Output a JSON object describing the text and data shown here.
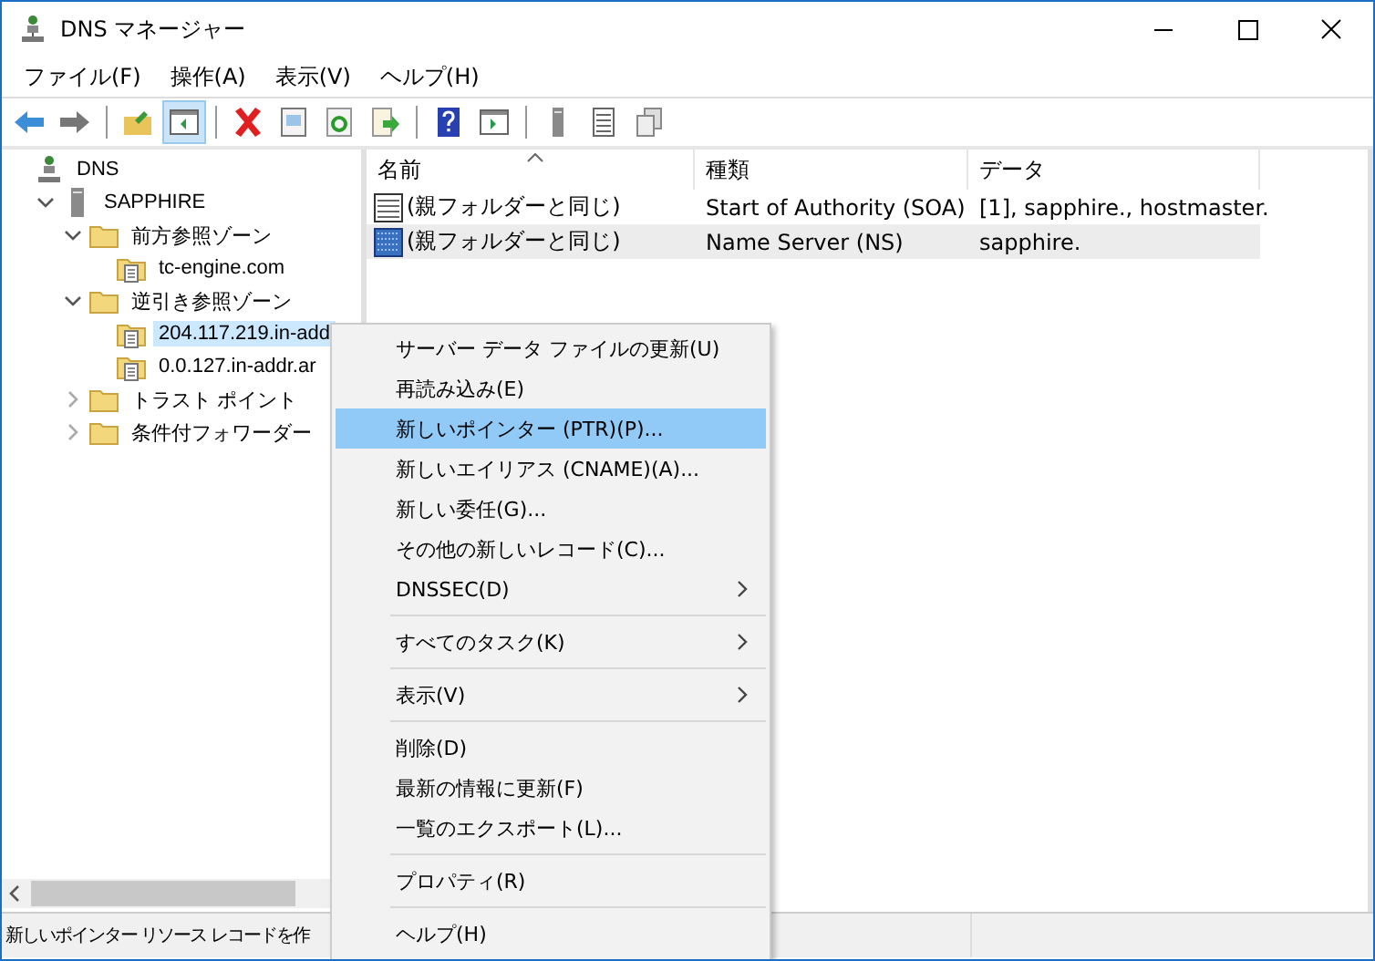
{
  "window": {
    "title": "DNS マネージャー"
  },
  "menu_bar": [
    "ファイル(F)",
    "操作(A)",
    "表示(V)",
    "ヘルプ(H)"
  ],
  "toolbar": [
    {
      "kind": "back",
      "pressed": false
    },
    {
      "kind": "forward",
      "pressed": false
    },
    {
      "kind": "separator"
    },
    {
      "kind": "up",
      "pressed": false
    },
    {
      "kind": "pane",
      "pressed": true
    },
    {
      "kind": "separator"
    },
    {
      "kind": "delete",
      "pressed": false
    },
    {
      "kind": "properties",
      "pressed": false
    },
    {
      "kind": "refresh",
      "pressed": false
    },
    {
      "kind": "export",
      "pressed": false
    },
    {
      "kind": "separator"
    },
    {
      "kind": "help",
      "pressed": false
    },
    {
      "kind": "action",
      "pressed": false
    },
    {
      "kind": "separator"
    },
    {
      "kind": "server",
      "pressed": false
    },
    {
      "kind": "list",
      "pressed": false
    },
    {
      "kind": "copy",
      "pressed": false
    }
  ],
  "tree": [
    {
      "label": "DNS",
      "kind": "root",
      "selected": false,
      "children": [
        {
          "label": "SAPPHIRE",
          "kind": "server",
          "selected": false,
          "expanded": true,
          "children": [
            {
              "label": "前方参照ゾーン",
              "kind": "folder",
              "selected": false,
              "expanded": true,
              "children": [
                {
                  "label": "tc-engine.com",
                  "kind": "zone",
                  "selected": false
                }
              ]
            },
            {
              "label": "逆引き参照ゾーン",
              "kind": "folder",
              "selected": false,
              "expanded": true,
              "children": [
                {
                  "label": "204.117.219.in-add",
                  "kind": "zone",
                  "selected": true
                },
                {
                  "label": "0.0.127.in-addr.ar",
                  "kind": "zone",
                  "selected": false
                }
              ]
            },
            {
              "label": "トラスト ポイント",
              "kind": "folder",
              "selected": false,
              "expanded": false
            },
            {
              "label": "条件付フォワーダー",
              "kind": "folder",
              "selected": false,
              "expanded": false
            }
          ]
        }
      ]
    }
  ],
  "table": {
    "columns": [
      "名前",
      "種類",
      "データ"
    ],
    "rows": [
      {
        "kind": "soa",
        "cells": [
          "(親フォルダーと同じ)",
          "Start of Authority (SOA)",
          "[1], sapphire., hostmaster."
        ],
        "selected": false
      },
      {
        "kind": "ns",
        "cells": [
          "(親フォルダーと同じ)",
          "Name Server (NS)",
          "sapphire."
        ],
        "selected": true
      }
    ]
  },
  "context_menu": [
    {
      "kind": "item",
      "label": "サーバー データ ファイルの更新(U)",
      "selected": false,
      "submenu": false
    },
    {
      "kind": "item",
      "label": "再読み込み(E)",
      "selected": false,
      "submenu": false
    },
    {
      "kind": "item",
      "label": "新しいポインター (PTR)(P)...",
      "selected": true,
      "submenu": false
    },
    {
      "kind": "item",
      "label": "新しいエイリアス (CNAME)(A)...",
      "selected": false,
      "submenu": false
    },
    {
      "kind": "item",
      "label": "新しい委任(G)...",
      "selected": false,
      "submenu": false
    },
    {
      "kind": "item",
      "label": "その他の新しいレコード(C)...",
      "selected": false,
      "submenu": false
    },
    {
      "kind": "item",
      "label": "DNSSEC(D)",
      "selected": false,
      "submenu": true
    },
    {
      "kind": "separator"
    },
    {
      "kind": "item",
      "label": "すべてのタスク(K)",
      "selected": false,
      "submenu": true
    },
    {
      "kind": "separator"
    },
    {
      "kind": "item",
      "label": "表示(V)",
      "selected": false,
      "submenu": true
    },
    {
      "kind": "separator"
    },
    {
      "kind": "item",
      "label": "削除(D)",
      "selected": false,
      "submenu": false
    },
    {
      "kind": "item",
      "label": "最新の情報に更新(F)",
      "selected": false,
      "submenu": false
    },
    {
      "kind": "item",
      "label": "一覧のエクスポート(L)...",
      "selected": false,
      "submenu": false
    },
    {
      "kind": "separator"
    },
    {
      "kind": "item",
      "label": "プロパティ(R)",
      "selected": false,
      "submenu": false
    },
    {
      "kind": "separator"
    },
    {
      "kind": "item",
      "label": "ヘルプ(H)",
      "selected": false,
      "submenu": false
    }
  ],
  "status_bar": "新しいポインター リソース レコードを作"
}
